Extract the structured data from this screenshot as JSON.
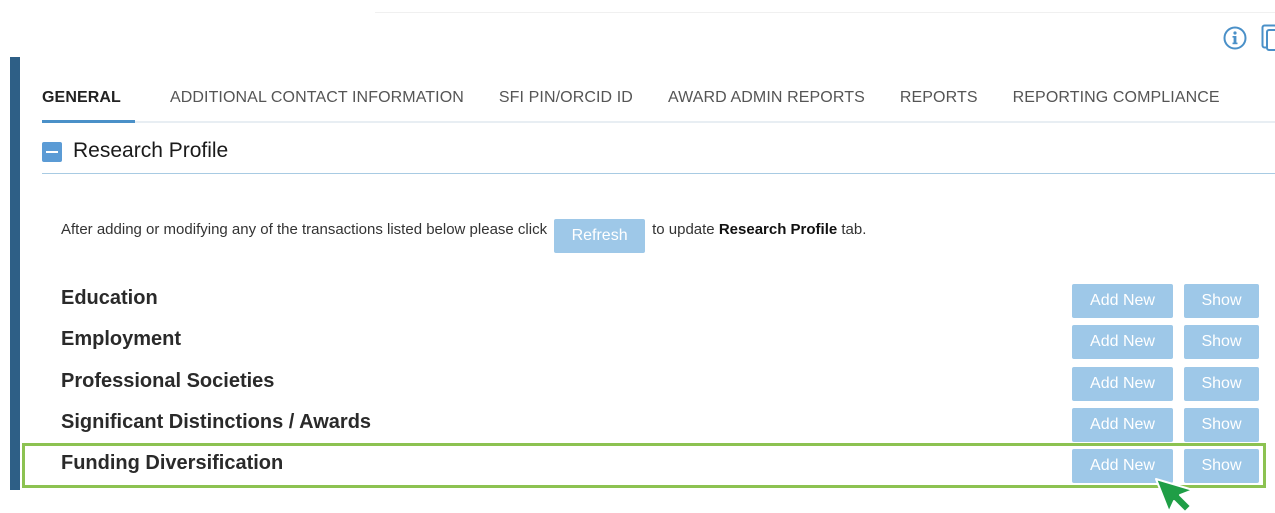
{
  "tabs": [
    {
      "label": "GENERAL",
      "active": true
    },
    {
      "label": "ADDITIONAL CONTACT INFORMATION",
      "active": false
    },
    {
      "label": "SFI PIN/ORCID ID",
      "active": false
    },
    {
      "label": "AWARD ADMIN REPORTS",
      "active": false
    },
    {
      "label": "REPORTS",
      "active": false
    },
    {
      "label": "REPORTING COMPLIANCE",
      "active": false
    }
  ],
  "section": {
    "title": "Research Profile",
    "toggle_icon": "minus-square-icon"
  },
  "notice": {
    "before": "After adding or modifying any of the transactions listed below please click",
    "refresh_label": "Refresh",
    "after_prefix": "to update",
    "after_bold": "Research Profile",
    "after_suffix": "tab."
  },
  "rows": [
    {
      "label": "Education",
      "add_label": "Add New",
      "show_label": "Show"
    },
    {
      "label": "Employment",
      "add_label": "Add New",
      "show_label": "Show"
    },
    {
      "label": "Professional Societies",
      "add_label": "Add New",
      "show_label": "Show"
    },
    {
      "label": "Significant Distinctions / Awards",
      "add_label": "Add New",
      "show_label": "Show"
    },
    {
      "label": "Funding Diversification",
      "add_label": "Add New",
      "show_label": "Show",
      "highlighted": true
    }
  ],
  "icons": {
    "info": "info-circle-icon",
    "copy": "copy-icon",
    "cursor": "pointer-arrow-icon"
  },
  "colors": {
    "accent": "#4a90c8",
    "button": "#9ec8e8",
    "highlight": "#8cc251",
    "cursor": "#1f9e46",
    "left_bar": "#2e5f86"
  }
}
